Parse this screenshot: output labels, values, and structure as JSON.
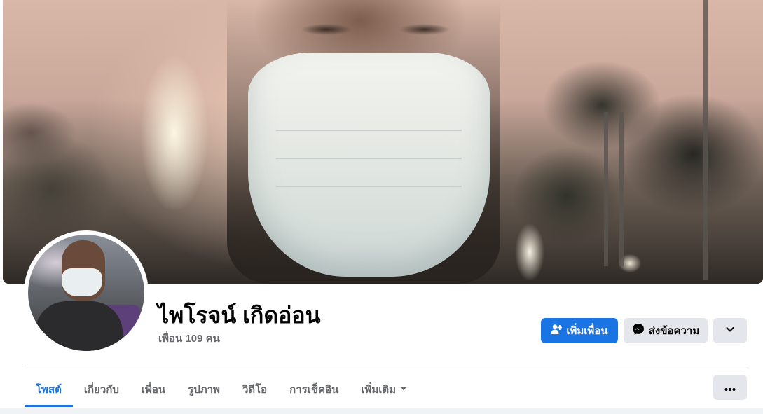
{
  "profile": {
    "name": "ไพโรจน์ เกิดอ่อน",
    "friends_count": "เพื่อน 109 คน"
  },
  "actions": {
    "add_friend": "เพิ่มเพื่อน",
    "message": "ส่งข้อความ"
  },
  "tabs": [
    {
      "label": "โพสต์",
      "active": true
    },
    {
      "label": "เกี่ยวกับ"
    },
    {
      "label": "เพื่อน"
    },
    {
      "label": "รูปภาพ"
    },
    {
      "label": "วิดีโอ"
    },
    {
      "label": "การเช็คอิน"
    },
    {
      "label": "เพิ่มเติม"
    }
  ],
  "icons": {
    "add_friend": "person-plus-icon",
    "message": "messenger-icon",
    "dropdown": "chevron-down-icon",
    "more_tab": "caret-down-icon",
    "more_options": "ellipsis-icon"
  },
  "colors": {
    "primary": "#1b74e4",
    "secondary_button": "#e4e6eb",
    "text": "#050505",
    "muted_text": "#65676b"
  }
}
